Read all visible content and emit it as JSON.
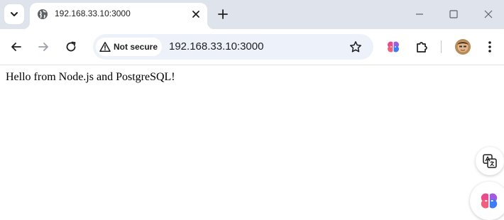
{
  "tab": {
    "title": "192.168.33.10:3000"
  },
  "omnibox": {
    "security_label": "Not secure",
    "url": "192.168.33.10:3000"
  },
  "page": {
    "body_text": "Hello from Node.js and PostgreSQL!"
  },
  "icons": {
    "tab_search": "chevron-down-icon",
    "favicon": "globe-icon",
    "tab_close": "close-icon",
    "new_tab": "plus-icon",
    "minimize": "minimize-icon",
    "maximize": "maximize-icon",
    "window_close": "close-icon",
    "back": "arrow-left-icon",
    "forward": "arrow-right-icon",
    "reload": "reload-icon",
    "security": "warning-triangle-icon",
    "bookmark": "star-icon",
    "ai_assistant": "brain-icon",
    "extensions": "puzzle-icon",
    "menu": "more-vertical-icon",
    "translate": "translate-icon"
  },
  "colors": {
    "tabstrip_bg": "#dfe3eb",
    "omnibox_bg": "#edf2fa",
    "accent_pink": "#e84c8a",
    "accent_blue": "#3d7cf5"
  }
}
